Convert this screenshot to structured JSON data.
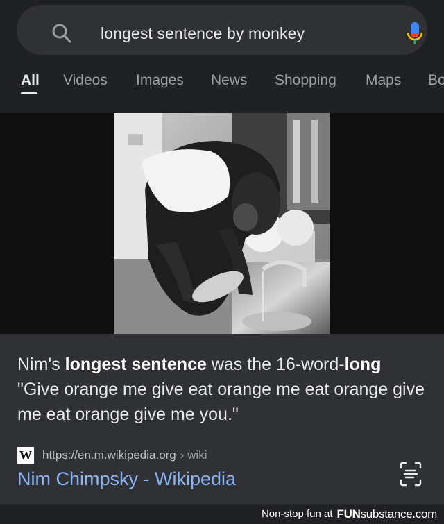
{
  "search": {
    "query": "longest sentence by monkey"
  },
  "tabs": [
    {
      "label": "All",
      "active": true
    },
    {
      "label": "Videos"
    },
    {
      "label": "Images"
    },
    {
      "label": "News"
    },
    {
      "label": "Shopping"
    },
    {
      "label": "Maps"
    },
    {
      "label": "Bo"
    }
  ],
  "snippet": {
    "part1": "Nim's ",
    "bold1": "longest sentence",
    "part2": " was the 16-word-",
    "bold2": "long",
    "part3": " \"Give orange me give eat orange me eat orange give me eat orange give me you.\""
  },
  "result": {
    "favicon_letter": "W",
    "url": "https://en.m.wikipedia.org",
    "path": "› wiki",
    "title": "Nim Chimpsky - Wikipedia"
  },
  "footer": {
    "tagline": "Non-stop fun at",
    "brand_bold": "FUN",
    "brand_rest": "substance.com"
  },
  "colors": {
    "background": "#202124",
    "card": "#303134",
    "link": "#8ab4f8",
    "mic_blue": "#4285f4",
    "mic_red": "#ea4335",
    "mic_yellow": "#fbbc04",
    "mic_green": "#34a853"
  },
  "icons": {
    "search": "search-icon",
    "mic": "microphone-icon",
    "lens": "google-lens-icon",
    "favicon": "wikipedia-icon"
  }
}
